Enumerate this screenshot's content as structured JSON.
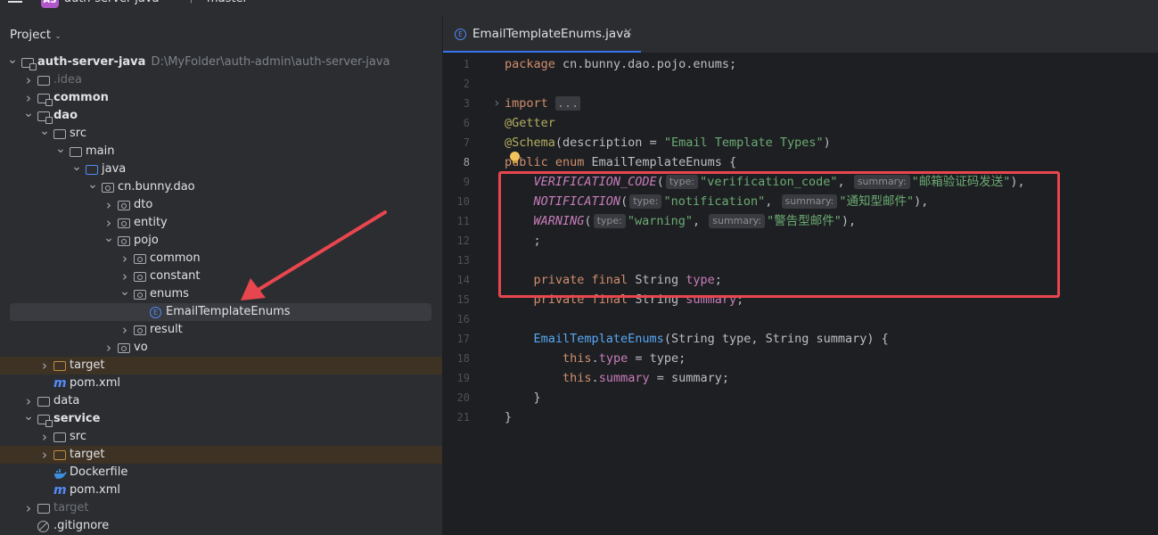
{
  "window": {
    "project_badge": "AS",
    "project_name": "auth-server-java",
    "branch": "master"
  },
  "project_panel": {
    "title": "Project",
    "tree": [
      {
        "label": "auth-server-java",
        "path": "D:\\MyFolder\\auth-admin\\auth-server-java",
        "depth": 0,
        "expanded": true,
        "icon": "module-folder-icon",
        "bold": true
      },
      {
        "label": ".idea",
        "depth": 1,
        "expanded": false,
        "icon": "folder-icon",
        "dim": true
      },
      {
        "label": "common",
        "depth": 1,
        "expanded": false,
        "icon": "module-folder-icon",
        "bold": true
      },
      {
        "label": "dao",
        "depth": 1,
        "expanded": true,
        "icon": "module-folder-icon",
        "bold": true
      },
      {
        "label": "src",
        "depth": 2,
        "expanded": true,
        "icon": "folder-icon"
      },
      {
        "label": "main",
        "depth": 3,
        "expanded": true,
        "icon": "folder-icon"
      },
      {
        "label": "java",
        "depth": 4,
        "expanded": true,
        "icon": "source-folder-icon"
      },
      {
        "label": "cn.bunny.dao",
        "depth": 5,
        "expanded": true,
        "icon": "package-icon"
      },
      {
        "label": "dto",
        "depth": 6,
        "expanded": false,
        "icon": "package-icon"
      },
      {
        "label": "entity",
        "depth": 6,
        "expanded": false,
        "icon": "package-icon"
      },
      {
        "label": "pojo",
        "depth": 6,
        "expanded": true,
        "icon": "package-icon"
      },
      {
        "label": "common",
        "depth": 7,
        "expanded": false,
        "icon": "package-icon"
      },
      {
        "label": "constant",
        "depth": 7,
        "expanded": false,
        "icon": "package-icon"
      },
      {
        "label": "enums",
        "depth": 7,
        "expanded": true,
        "icon": "package-icon"
      },
      {
        "label": "EmailTemplateEnums",
        "depth": 8,
        "leaf": true,
        "icon": "enum-class-icon",
        "selected": true
      },
      {
        "label": "result",
        "depth": 7,
        "expanded": false,
        "icon": "package-icon"
      },
      {
        "label": "vo",
        "depth": 6,
        "expanded": false,
        "icon": "package-icon"
      },
      {
        "label": "target",
        "depth": 2,
        "expanded": false,
        "icon": "excluded-folder-icon",
        "excluded": true
      },
      {
        "label": "pom.xml",
        "depth": 2,
        "leaf": true,
        "icon": "maven-icon"
      },
      {
        "label": "data",
        "depth": 1,
        "expanded": false,
        "icon": "folder-icon"
      },
      {
        "label": "service",
        "depth": 1,
        "expanded": true,
        "icon": "module-folder-icon",
        "bold": true
      },
      {
        "label": "src",
        "depth": 2,
        "expanded": false,
        "icon": "folder-icon"
      },
      {
        "label": "target",
        "depth": 2,
        "expanded": false,
        "icon": "excluded-folder-icon",
        "excluded": true
      },
      {
        "label": "Dockerfile",
        "depth": 2,
        "leaf": true,
        "icon": "docker-icon"
      },
      {
        "label": "pom.xml",
        "depth": 2,
        "leaf": true,
        "icon": "maven-icon"
      },
      {
        "label": "target",
        "depth": 1,
        "expanded": false,
        "icon": "folder-icon",
        "dim": true
      },
      {
        "label": ".gitignore",
        "depth": 1,
        "leaf": true,
        "icon": "ignore-file-icon"
      }
    ]
  },
  "editor": {
    "tab": {
      "label": "EmailTemplateEnums.java",
      "close": "×"
    },
    "current_line": 8,
    "lines": [
      {
        "n": "1",
        "html": "<span class=\"kw\">package</span> cn.bunny.dao.pojo.enums;"
      },
      {
        "n": "2",
        "html": ""
      },
      {
        "n": "3",
        "html": "<span class=\"kw\">import</span> <span class=\"dots\">...</span>",
        "fold": true
      },
      {
        "n": "6",
        "html": ""
      },
      {
        "n": "6",
        "html": "<span class=\"ann\">@Getter</span>"
      },
      {
        "n": "7",
        "html": "<span class=\"ann\">@Schema</span>(description = <span class=\"str\">\"Email Template Types\"</span>)"
      },
      {
        "n": "8",
        "html": "<span class=\"kw\">public enum</span> EmailTemplateEnums {"
      },
      {
        "n": "9",
        "html": "    <span class=\"enc\">VERIFICATION_CODE</span>(<span class=\"hint\">type:</span><span class=\"str\">\"verification_code\"</span>, <span class=\"hint\">summary:</span><span class=\"str\">\"邮箱验证码发送\"</span>),"
      },
      {
        "n": "10",
        "html": "    <span class=\"enc\">NOTIFICATION</span>(<span class=\"hint\">type:</span><span class=\"str\">\"notification\"</span>, <span class=\"hint\">summary:</span><span class=\"str\">\"通知型邮件\"</span>),"
      },
      {
        "n": "11",
        "html": "    <span class=\"enc\">WARNING</span>(<span class=\"hint\">type:</span><span class=\"str\">\"warning\"</span>, <span class=\"hint\">summary:</span><span class=\"str\">\"警告型邮件\"</span>),"
      },
      {
        "n": "12",
        "html": "    ;"
      },
      {
        "n": "13",
        "html": ""
      },
      {
        "n": "14",
        "html": "    <span class=\"kw\">private final</span> String <span class=\"fld\">type</span>;"
      },
      {
        "n": "15",
        "html": "    <span class=\"kw\">private final</span> String <span class=\"fld\">summary</span>;"
      },
      {
        "n": "16",
        "html": ""
      },
      {
        "n": "17",
        "html": "    <span class=\"mcall\">EmailTemplateEnums</span>(String type, String summary) {"
      },
      {
        "n": "18",
        "html": "        <span class=\"kw\">this</span>.<span class=\"fld\">type</span> = type;"
      },
      {
        "n": "19",
        "html": "        <span class=\"kw\">this</span>.<span class=\"fld\">summary</span> = summary;"
      },
      {
        "n": "20",
        "html": "    }"
      },
      {
        "n": "21",
        "html": "}"
      }
    ]
  },
  "colors": {
    "annotation_red": "#e8464e",
    "accent": "#3574f0"
  }
}
